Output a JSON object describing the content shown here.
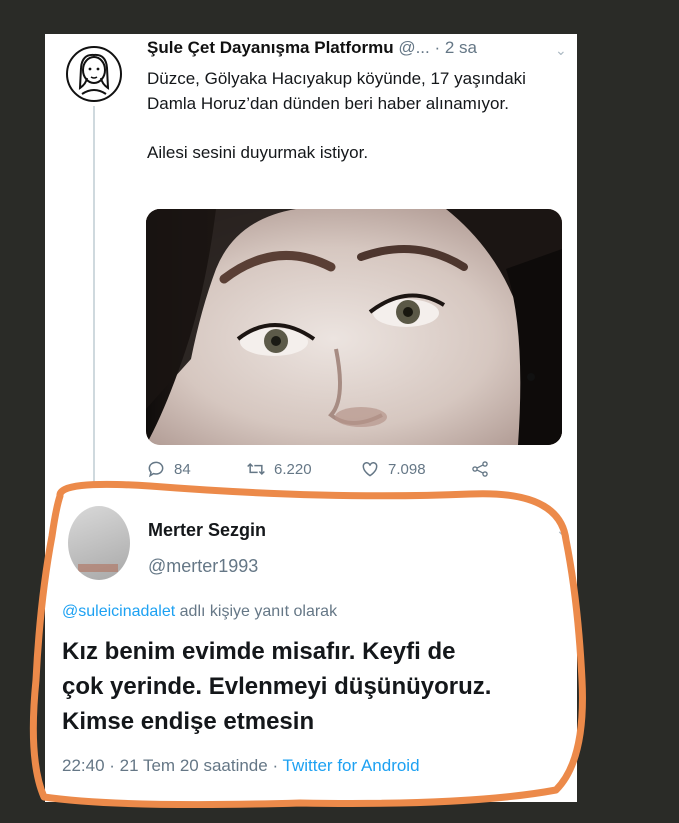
{
  "tweet": {
    "author_name": "Şule Çet Dayanışma Platformu",
    "author_handle": "@...",
    "time_ago": "· 2 sa",
    "lines": [
      "Düzce, Gölyaka Hacıyakup köyünde, 17 yaşındaki Damla Horuz’dan dünden beri haber alınamıyor.",
      "Ailesi sesini duyurmak istiyor."
    ],
    "replies": "84",
    "retweets": "6.220",
    "likes": "7.098",
    "icons": [
      "reply-icon",
      "retweet-icon",
      "like-icon",
      "share-icon"
    ]
  },
  "reply": {
    "name": "Merter Sezgin",
    "handle": "@merter1993",
    "replying_mention": "@suleicinadalet",
    "replying_rest": "adlı kişiye yanıt olarak",
    "body_lines": [
      "Kız benim evimde misafır. Keyfi de",
      "çok yerinde. Evlenmeyi düşünüyoruz.",
      "Kimse endişe etmesin"
    ],
    "footer_time": "22:40 · 21 Tem 20 saatinde ·",
    "footer_client": "Twitter for Android"
  },
  "colors": {
    "background": "#2a2b27",
    "link": "#1da1f2",
    "muted": "#657786",
    "annotation_stroke": "#ec8a4a"
  }
}
